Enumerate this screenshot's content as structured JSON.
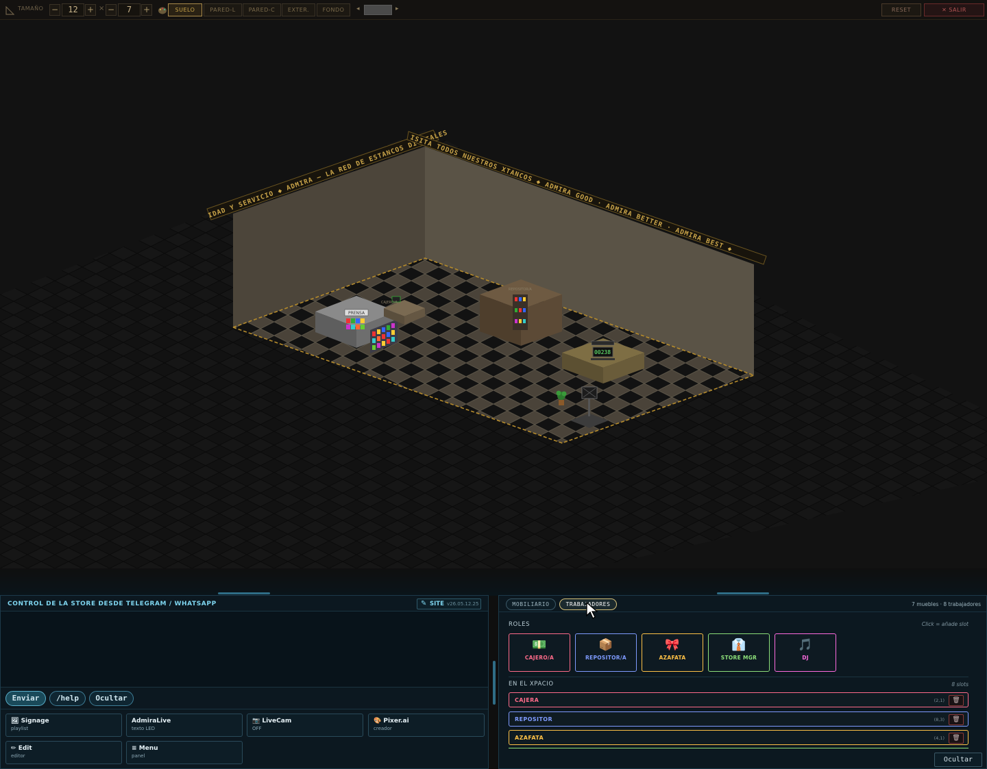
{
  "toolbar": {
    "size_label": "TAMAÑO",
    "width_value": "12",
    "height_value": "7",
    "times": "×",
    "minus": "−",
    "plus": "+",
    "modes": [
      "SUELO",
      "PARED-L",
      "PARED-C",
      "EXTER.",
      "FONDO"
    ],
    "active_mode": "SUELO",
    "prev": "◂",
    "next": "▸",
    "reset_label": "RESET",
    "exit_label": "✕ SALIR"
  },
  "scene": {
    "banner_left": "IDAD Y SERVICIO  ◆  ADMIRA — LA RED DE ESTANCOS DIGITALES",
    "banner_right": "ISITA TODOS NUESTROS XTANCOS  ◆  ADMIRA GOOD · ADMIRA BETTER · ADMIRA BEST  ◆",
    "label_prensa": "PRENSA",
    "label_cajero": "CAJERO/A",
    "label_repositor": "REPOSITOR/A",
    "counter_value": "00238"
  },
  "chat": {
    "title": "CONTROL DE LA STORE DESDE TELEGRAM / WHATSAPP",
    "site_label": "SITE",
    "version": "v26.05.12.25",
    "send_label": "Enviar",
    "help_label": "/help",
    "hide_label": "Ocultar",
    "apps": [
      {
        "icon": "🖼",
        "title": "Signage",
        "sub": "playlist"
      },
      {
        "icon": "",
        "title": "AdmiraLive",
        "sub": "texto LED"
      },
      {
        "icon": "📷",
        "title": "LiveCam",
        "sub": "OFF"
      },
      {
        "icon": "🎨",
        "title": "Pixer.ai",
        "sub": "creador"
      },
      {
        "icon": "✏",
        "title": "Edit",
        "sub": "editor"
      },
      {
        "icon": "≡",
        "title": "Menu",
        "sub": "panel"
      }
    ]
  },
  "workers": {
    "tab_furniture": "MOBILIARIO",
    "tab_workers": "TRABAJADORES",
    "summary": "7 muebles · 8 trabajadores",
    "roles_heading": "ROLES",
    "roles_hint": "Click = añade slot",
    "roles": [
      {
        "icon": "💵",
        "label": "CAJERO/A",
        "color": "#ff6b8a"
      },
      {
        "icon": "📦",
        "label": "REPOSITOR/A",
        "color": "#7f9bff"
      },
      {
        "icon": "🎀",
        "label": "AZAFATA",
        "color": "#ffc247"
      },
      {
        "icon": "👔",
        "label": "STORE MGR",
        "color": "#8de07a"
      },
      {
        "icon": "🎵",
        "label": "DJ",
        "color": "#ff6be0"
      }
    ],
    "space_heading": "EN EL XPACIO",
    "space_count": "8 slots",
    "slots": [
      {
        "name": "CAJERA",
        "coord": "(2,1)",
        "color": "#ff6b8a"
      },
      {
        "name": "REPOSITOR",
        "coord": "(8,3)",
        "color": "#7f9bff"
      },
      {
        "name": "AZAFATA",
        "coord": "(4,1)",
        "color": "#ffc247"
      }
    ],
    "hide_label": "Ocultar"
  }
}
